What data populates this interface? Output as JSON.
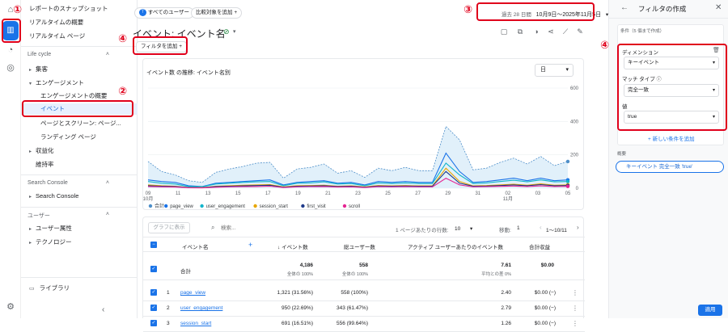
{
  "annotations": {
    "n1": "①",
    "n2": "②",
    "n3": "③",
    "n4a": "④",
    "n4b": "④"
  },
  "sidebar": {
    "top_items": [
      "レポートのスナップショット",
      "リアルタイムの概要",
      "リアルタイム ページ"
    ],
    "lifecycle": {
      "title": "Life cycle",
      "items": [
        {
          "label": "集客",
          "level": 0,
          "expand": "▸"
        },
        {
          "label": "エンゲージメント",
          "level": 0,
          "expand": "▾"
        },
        {
          "label": "エンゲージメントの概要",
          "level": 1
        },
        {
          "label": "イベント",
          "level": 1,
          "selected": true
        },
        {
          "label": "ページとスクリーン: ページ...",
          "level": 1
        },
        {
          "label": "ランディング ページ",
          "level": 1
        },
        {
          "label": "収益化",
          "level": 0,
          "expand": "▸"
        },
        {
          "label": "維持率",
          "level": 0
        }
      ]
    },
    "search_console": {
      "title": "Search Console",
      "item": "Search Console"
    },
    "user": {
      "title": "ユーザー",
      "items": [
        "ユーザー属性",
        "テクノロジー"
      ]
    },
    "library": "ライブラリ"
  },
  "header": {
    "all_users": "すべてのユーザー",
    "compare": "比較対象を追加",
    "date_label": "過去 28 日間",
    "date_range": "10月9日～2025年11月5日",
    "title": "イベント: イベント名",
    "add_filter": "フィルタを追加"
  },
  "chart_card": {
    "title": "イベント数 の推移: イベント名別",
    "granularity": "日"
  },
  "chart_data": {
    "type": "line",
    "y_ticks": [
      "600",
      "400",
      "200",
      "0"
    ],
    "ylim": [
      0,
      600
    ],
    "x_ticks": [
      "09\n10月",
      "11",
      "13",
      "15",
      "17",
      "19",
      "21",
      "23",
      "25",
      "27",
      "29",
      "31",
      "02\n11月",
      "03",
      "05"
    ],
    "series": [
      {
        "name": "合計",
        "color": "#4e8fc9",
        "values": [
          160,
          100,
          80,
          45,
          35,
          95,
          115,
          130,
          150,
          155,
          60,
          115,
          125,
          145,
          90,
          105,
          65,
          120,
          105,
          125,
          105,
          105,
          370,
          290,
          110,
          120,
          155,
          180,
          145,
          190,
          135,
          160
        ]
      },
      {
        "name": "page_view",
        "color": "#1a73e8",
        "values": [
          50,
          40,
          35,
          15,
          10,
          30,
          35,
          40,
          45,
          50,
          20,
          35,
          40,
          45,
          30,
          35,
          20,
          40,
          35,
          40,
          35,
          35,
          210,
          100,
          35,
          40,
          50,
          60,
          45,
          60,
          45,
          50
        ]
      },
      {
        "name": "user_engagement",
        "color": "#12b5cb",
        "values": [
          40,
          30,
          25,
          10,
          8,
          25,
          30,
          35,
          38,
          40,
          15,
          30,
          32,
          38,
          25,
          28,
          15,
          32,
          28,
          32,
          28,
          28,
          150,
          80,
          28,
          32,
          40,
          48,
          38,
          50,
          38,
          40
        ]
      },
      {
        "name": "session_start",
        "color": "#e8a600",
        "values": [
          20,
          15,
          12,
          5,
          4,
          12,
          15,
          18,
          20,
          22,
          8,
          15,
          16,
          18,
          12,
          14,
          8,
          16,
          14,
          16,
          14,
          14,
          120,
          40,
          14,
          16,
          20,
          24,
          18,
          26,
          18,
          20
        ]
      },
      {
        "name": "first_visit",
        "color": "#1e3a8a",
        "values": [
          15,
          12,
          10,
          4,
          3,
          10,
          12,
          14,
          16,
          18,
          6,
          12,
          13,
          15,
          10,
          12,
          6,
          13,
          12,
          13,
          12,
          12,
          100,
          30,
          12,
          13,
          16,
          20,
          15,
          22,
          15,
          16
        ]
      },
      {
        "name": "scroll",
        "color": "#e52592",
        "values": [
          10,
          8,
          7,
          3,
          2,
          6,
          8,
          9,
          10,
          12,
          4,
          8,
          9,
          10,
          7,
          8,
          4,
          9,
          8,
          9,
          8,
          8,
          60,
          20,
          8,
          9,
          11,
          13,
          10,
          14,
          10,
          11
        ]
      }
    ]
  },
  "table": {
    "show_graph": "グラフに表示",
    "search_placeholder": "検索...",
    "rows_per_page_label": "1 ページあたりの行数:",
    "rows_per_page": "10",
    "move_label": "移動:",
    "move_value": "1",
    "range": "1〜10/11",
    "columns": [
      "イベント名",
      "イベント数",
      "総ユーザー数",
      "アクティブ ユーザーあたりのイベント数",
      "合計収益"
    ],
    "totals": {
      "label": "合計",
      "events": "4,186",
      "events_sub": "全体の 100%",
      "users": "558",
      "users_sub": "全体の 100%",
      "per_user": "7.61",
      "per_user_sub": "平均との差 0%",
      "revenue": "$0.00"
    },
    "rows": [
      {
        "num": "1",
        "name": "page_view",
        "events": "1,321 (31.56%)",
        "users": "558 (100%)",
        "per_user": "2.40",
        "revenue": "$0.00 (−)"
      },
      {
        "num": "2",
        "name": "user_engagement",
        "events": "950 (22.69%)",
        "users": "343 (61.47%)",
        "per_user": "2.79",
        "revenue": "$0.00 (−)"
      },
      {
        "num": "3",
        "name": "session_start",
        "events": "691 (16.51%)",
        "users": "556 (99.64%)",
        "per_user": "1.26",
        "revenue": "$0.00 (−)"
      }
    ]
  },
  "panel": {
    "title": "フィルタの作成",
    "cond_header": "条件（5 個まで作成）",
    "dimension_label": "ディメンション",
    "dimension_value": "キーイベント",
    "match_label": "マッチ タイプ",
    "match_value": "完全一致",
    "value_label": "値",
    "value_value": "true",
    "add_condition": "新しい条件を追加",
    "summary_label": "概要",
    "summary_chip": "キーイベント 完全一致 'true'",
    "apply": "適用"
  },
  "colors": {
    "accent": "#1a73e8",
    "highlight": "#e0001b",
    "nav_selected_bg": "#e8f0fe"
  }
}
